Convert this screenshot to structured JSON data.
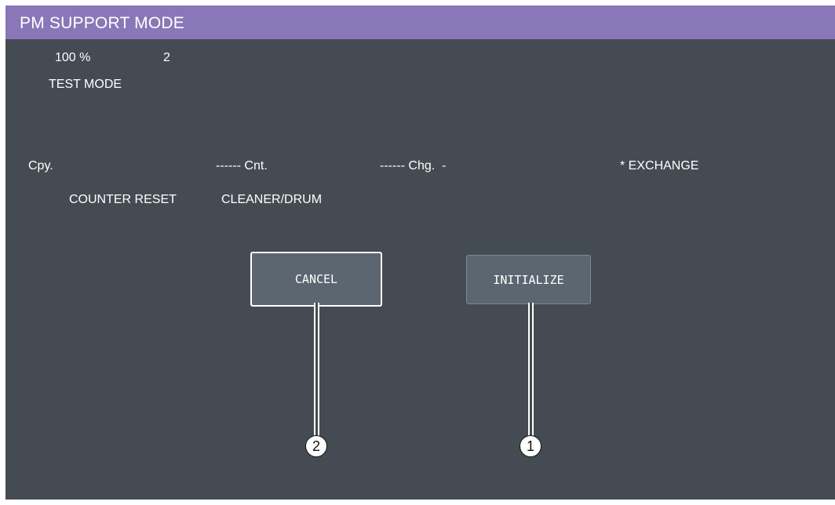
{
  "window": {
    "title": "PM SUPPORT MODE"
  },
  "status": {
    "zoom": "100 %",
    "copies": "2",
    "mode": "TEST MODE"
  },
  "info_row": {
    "cpy": "Cpy.",
    "cnt": "------ Cnt.",
    "chg": "------ Chg.  -",
    "exchange": "* EXCHANGE"
  },
  "reset_row": {
    "label": "COUNTER RESET",
    "target": "CLEANER/DRUM"
  },
  "buttons": {
    "cancel": "CANCEL",
    "initialize": "INITIALIZE"
  },
  "callouts": {
    "cancel": "2",
    "initialize": "1"
  }
}
